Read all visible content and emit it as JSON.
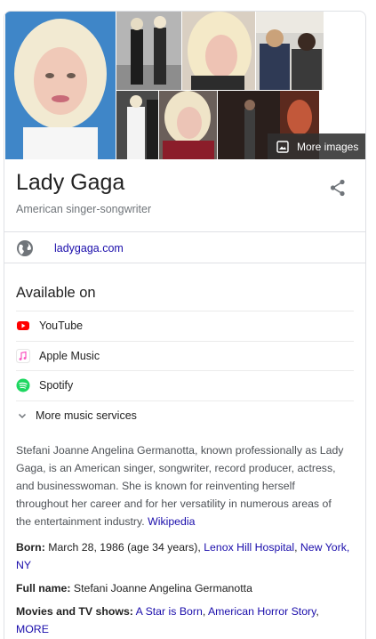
{
  "header": {
    "title": "Lady Gaga",
    "subtitle": "American singer-songwriter"
  },
  "images": {
    "more_label": "More images",
    "icons": {
      "more": "image-gallery-icon",
      "share": "share-icon"
    }
  },
  "website": {
    "icon": "globe-icon",
    "link": "ladygaga.com"
  },
  "available_on": {
    "title": "Available on",
    "services": [
      {
        "name": "YouTube",
        "icon": "youtube-icon",
        "color": "#ff0000"
      },
      {
        "name": "Apple Music",
        "icon": "apple-music-icon",
        "color": "#fa57c1"
      },
      {
        "name": "Spotify",
        "icon": "spotify-icon",
        "color": "#1ed760"
      }
    ],
    "more_label": "More music services"
  },
  "description": {
    "text": "Stefani Joanne Angelina Germanotta, known professionally as Lady Gaga, is an American singer, songwriter, record producer, actress, and businesswoman. She is known for reinventing herself throughout her career and for her versatility in numerous areas of the entertainment industry.",
    "source": "Wikipedia"
  },
  "facts": {
    "born": {
      "key": "Born:",
      "value": "March 28, 1986 (age 34 years),",
      "link1": "Lenox Hill Hospital",
      "link2": "New York, NY"
    },
    "full_name": {
      "key": "Full name:",
      "value": "Stefani Joanne Angelina Germanotta"
    },
    "movies": {
      "key": "Movies and TV shows:",
      "link1": "A Star is Born",
      "link2": "American Horror Story",
      "more": "MORE"
    }
  },
  "colors": {
    "link": "#1a0dab",
    "muted": "#70757a",
    "border": "#dfe1e5"
  }
}
